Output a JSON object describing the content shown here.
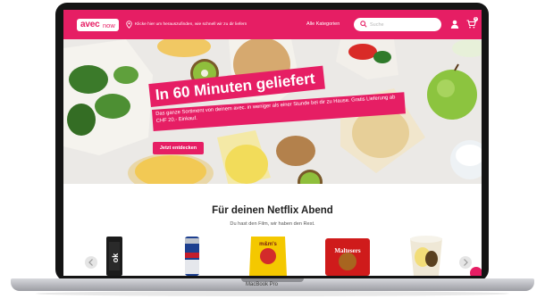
{
  "header": {
    "logo_main": "avec",
    "logo_sub": "now",
    "location_text": "Klicke hier um herauszufinden, wie schnell wir zu dir liefern",
    "categories_link": "Alle Kategorien",
    "search_placeholder": "Suche",
    "cart_count": "0"
  },
  "hero": {
    "title": "In 60 Minuten geliefert",
    "subtitle": "Das ganze Sortiment von deinem avec. in weniger als einer Stunde bei dir zu Hause. Gratis Lieferung ab CHF 20.- Einkauf.",
    "cta_label": "Jetzt entdecken"
  },
  "section": {
    "title": "Für deinen Netflix Abend",
    "subtitle": "Du hast den Film, wir haben den Rest."
  },
  "products": [
    {
      "name": "bottle",
      "label": "ok"
    },
    {
      "name": "energy-drink-can",
      "label": ""
    },
    {
      "name": "mms-peanut-bag",
      "label": "m&m's"
    },
    {
      "name": "maltesers-box",
      "label": "Maltesers"
    },
    {
      "name": "popcorn-cup",
      "label": ""
    }
  ],
  "device_label": "MacBook Pro",
  "colors": {
    "brand": "#e61e64",
    "laptop": "#141414"
  }
}
